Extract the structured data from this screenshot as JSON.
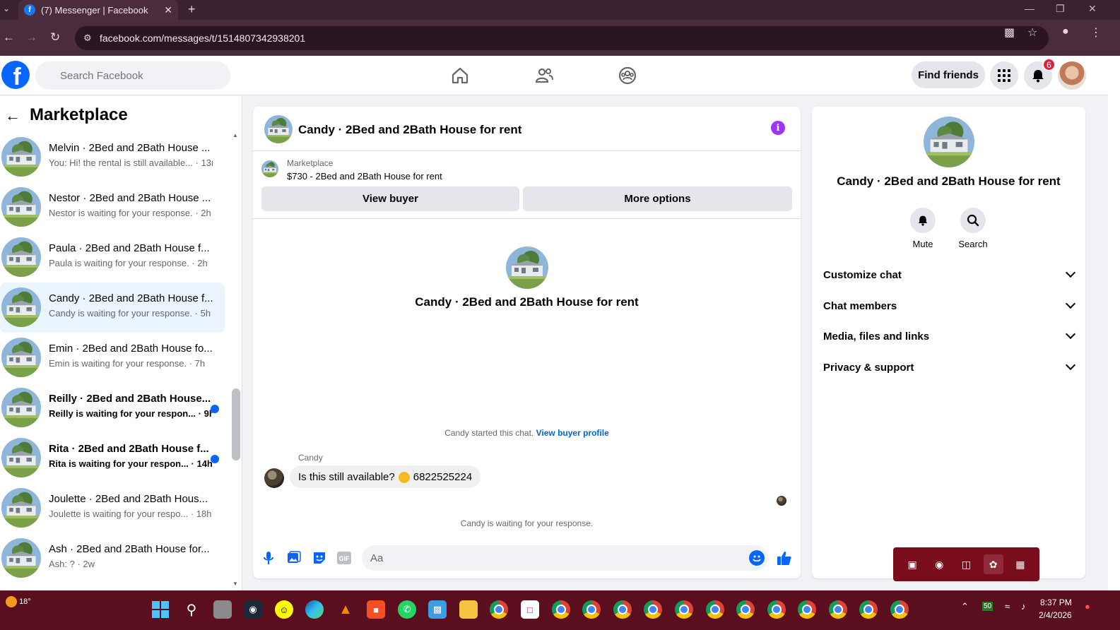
{
  "browser": {
    "tab_title": "(7) Messenger | Facebook",
    "url": "facebook.com/messages/t/1514807342938201"
  },
  "fb": {
    "search_placeholder": "Search Facebook",
    "find_friends": "Find friends",
    "notification_count": "6"
  },
  "sidebar": {
    "title": "Marketplace",
    "conversations": [
      {
        "name": "Melvin · 2Bed and 2Bath House ...",
        "preview": "You: Hi! the rental is still available... · 13m",
        "unread": false,
        "active": false
      },
      {
        "name": "Nestor · 2Bed and 2Bath House ...",
        "preview": "Nestor is waiting for your response. · 2h",
        "unread": false,
        "active": false
      },
      {
        "name": "Paula · 2Bed and 2Bath House f...",
        "preview": "Paula is waiting for your response. · 2h",
        "unread": false,
        "active": false
      },
      {
        "name": "Candy · 2Bed and 2Bath House f...",
        "preview": "Candy is waiting for your response. · 5h",
        "unread": false,
        "active": true
      },
      {
        "name": "Emin · 2Bed and 2Bath House fo...",
        "preview": "Emin is waiting for your response. · 7h",
        "unread": false,
        "active": false
      },
      {
        "name": "Reilly · 2Bed and 2Bath House...",
        "preview": "Reilly is waiting for your respon... · 9h",
        "unread": true,
        "active": false
      },
      {
        "name": "Rita · 2Bed and 2Bath House f...",
        "preview": "Rita is waiting for your respon... · 14h",
        "unread": true,
        "active": false
      },
      {
        "name": "Joulette · 2Bed and 2Bath Hous...",
        "preview": "Joulette is waiting for your respo... · 18h",
        "unread": false,
        "active": false
      },
      {
        "name": "Ash · 2Bed and 2Bath House for...",
        "preview": "Ash: ? · 2w",
        "unread": false,
        "active": false
      }
    ]
  },
  "chat": {
    "title": "Candy · 2Bed and 2Bath House for rent",
    "marketplace_label": "Marketplace",
    "listing": "$730 - 2Bed and 2Bath House for rent",
    "view_buyer": "View buyer",
    "more_options": "More options",
    "started_text": "Candy started this chat.",
    "view_buyer_profile": "View buyer profile",
    "sender": "Candy",
    "message_before": "Is this still available?",
    "message_after": "6822525224",
    "waiting": "Candy is waiting for your response.",
    "input_placeholder": "Aa"
  },
  "details": {
    "title": "Candy · 2Bed and 2Bath House for rent",
    "mute": "Mute",
    "search": "Search",
    "sections": [
      "Customize chat",
      "Chat members",
      "Media, files and links",
      "Privacy & support"
    ]
  },
  "taskbar": {
    "temperature": "18°",
    "time": "8:37 PM",
    "date": "2/4/2026",
    "battery": "50"
  }
}
